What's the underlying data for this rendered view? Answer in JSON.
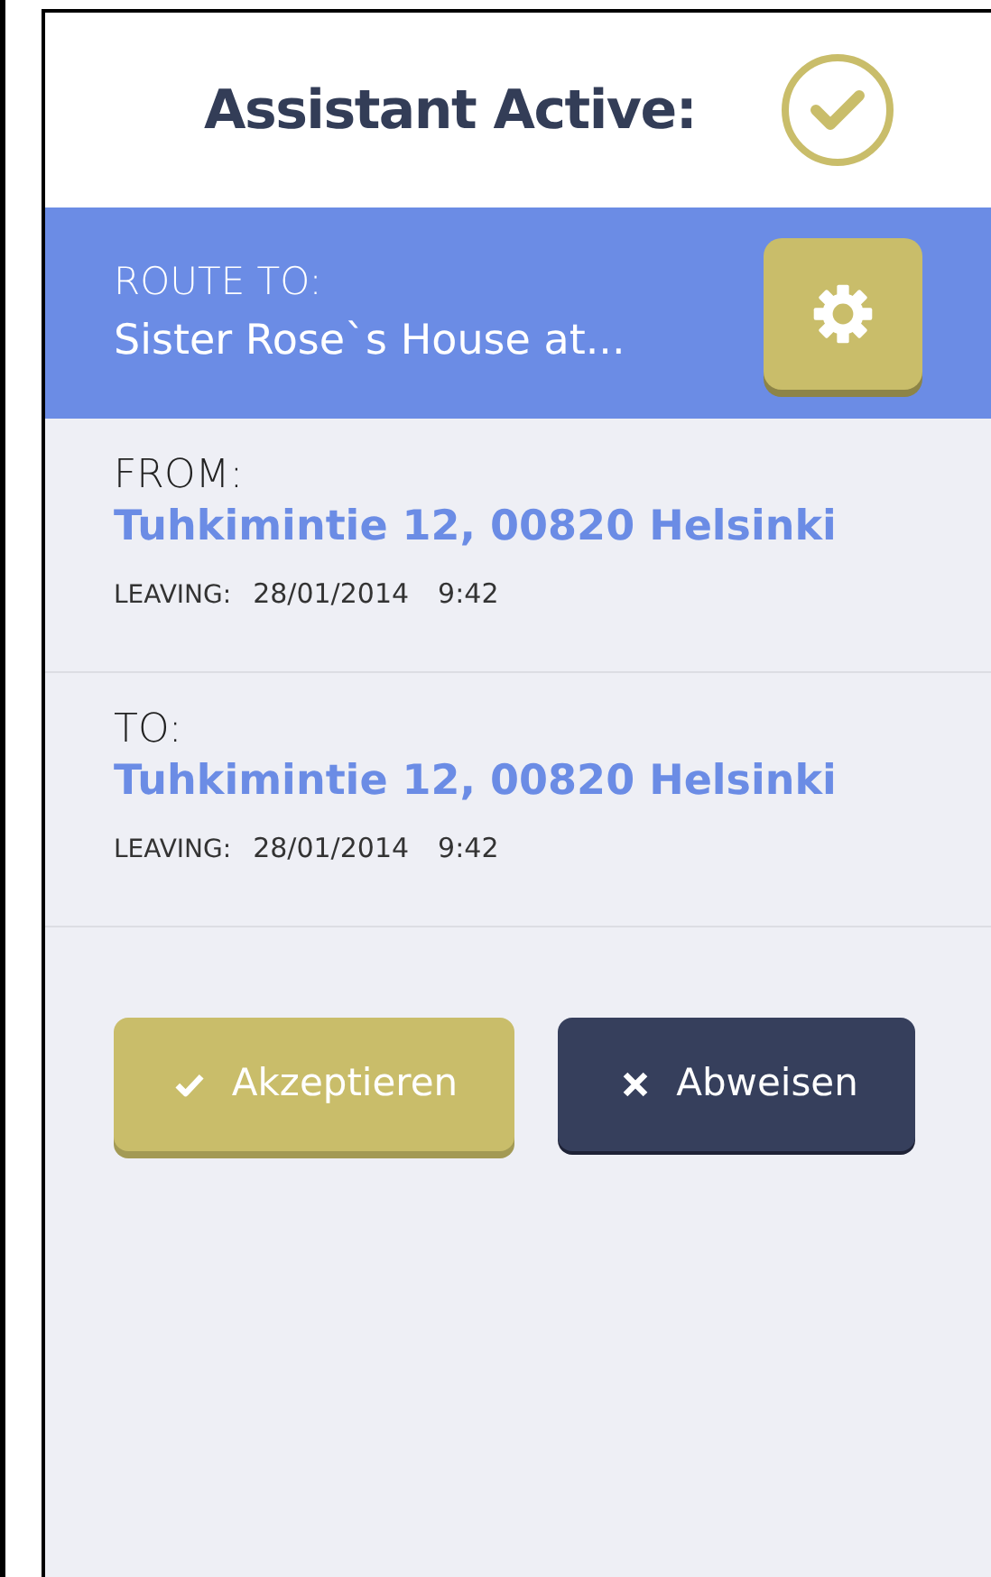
{
  "header": {
    "title": "Assistant Active:",
    "active": true
  },
  "route": {
    "label": "ROUTE TO:",
    "destination": "Sister Rose`s House at..."
  },
  "legs": [
    {
      "label": "FROM:",
      "address": "Tuhkimintie 12,  00820 Helsinki",
      "time_label": "LEAVING:",
      "date": "28/01/2014",
      "time": "9:42"
    },
    {
      "label": "TO:",
      "address": "Tuhkimintie 12,  00820 Helsinki",
      "time_label": "LEAVING:",
      "date": "28/01/2014",
      "time": "9:42"
    }
  ],
  "buttons": [
    {
      "kind": "accept",
      "label": "Akzeptieren"
    },
    {
      "kind": "reject",
      "label": "Abweisen"
    }
  ]
}
